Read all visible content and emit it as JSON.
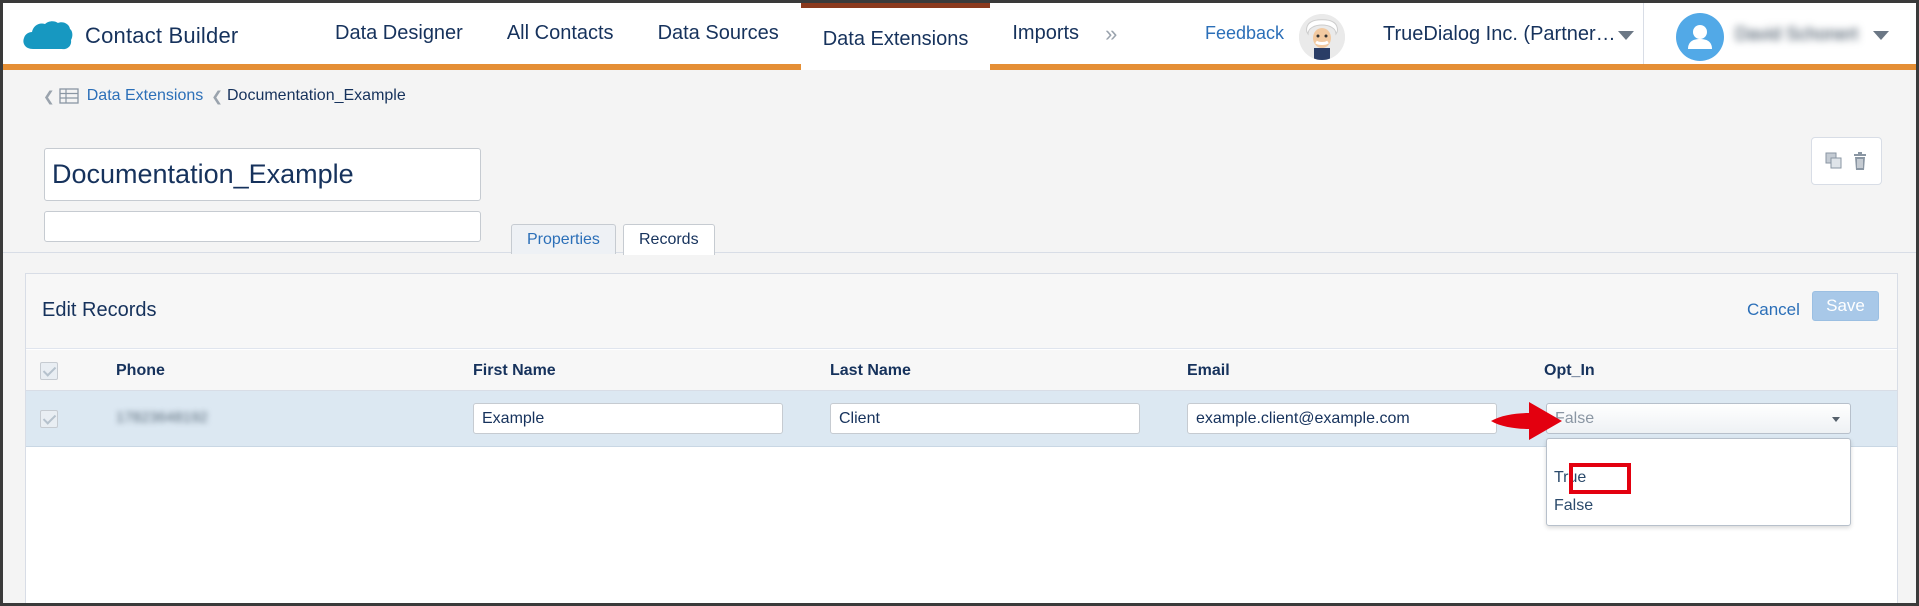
{
  "app": {
    "name": "Contact Builder"
  },
  "nav": {
    "tabs": [
      {
        "label": "Data Designer"
      },
      {
        "label": "All Contacts"
      },
      {
        "label": "Data Sources"
      },
      {
        "label": "Data Extensions"
      },
      {
        "label": "Imports"
      }
    ],
    "active_tab": "Data Extensions",
    "more": "»",
    "feedback": "Feedback",
    "org": "TrueDialog Inc. (Partner…",
    "user": "David Schonert"
  },
  "breadcrumb": {
    "sep": "❮",
    "parent": "Data Extensions",
    "current": "Documentation_Example"
  },
  "header": {
    "title_value": "Documentation_Example",
    "description_value": ""
  },
  "subtabs": {
    "properties": "Properties",
    "records": "Records"
  },
  "panel": {
    "title": "Edit Records",
    "cancel": "Cancel",
    "save": "Save"
  },
  "table": {
    "columns": [
      "Phone",
      "First Name",
      "Last Name",
      "Email",
      "Opt_In"
    ],
    "row": {
      "phone": "17823648192",
      "first_name": "Example",
      "last_name": "Client",
      "email": "example.client@example.com",
      "opt_in": "False"
    }
  },
  "dropdown": {
    "options": [
      "True",
      "False"
    ],
    "highlighted": "True"
  },
  "colors": {
    "accent_orange": "#e58f35",
    "active_tab_top": "#8b3a1e",
    "link_blue": "#2b6fb8",
    "highlight_red": "#e3000f",
    "row_selected": "#dce8f2"
  }
}
